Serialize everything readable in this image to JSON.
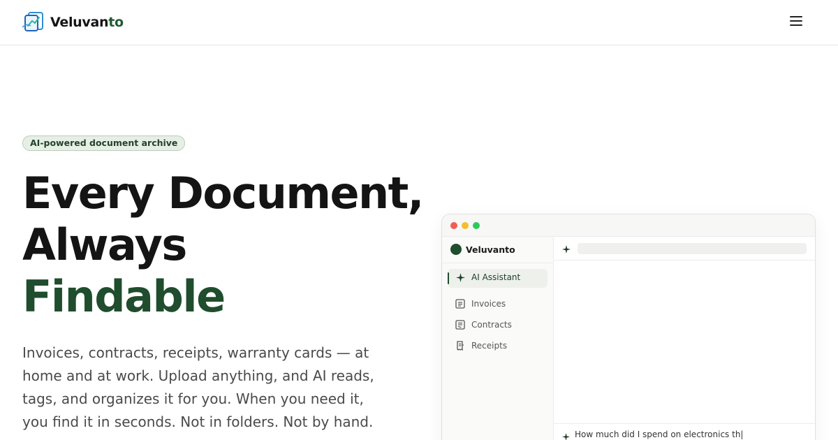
{
  "brand": {
    "name_main": "Veluvan",
    "name_accent": "to",
    "accent_color": "#1f5a33"
  },
  "header": {
    "menu_icon": "hamburger-menu-icon"
  },
  "hero": {
    "badge": "AI-powered document archive",
    "headline_line1": "Every Document,",
    "headline_line2": "Always",
    "headline_line3": "Findable",
    "description": "Invoices, contracts, receipts, warranty cards — at home and at work. Upload anything, and AI reads, tags, and organizes it for you. When you need it, you find it in seconds. Not in folders. Not by hand."
  },
  "app_preview": {
    "window_controls": [
      "close",
      "minimize",
      "maximize"
    ],
    "sidebar": {
      "brand": "Veluvanto",
      "items": [
        {
          "label": "AI Assistant",
          "icon": "sparkle-icon",
          "active": true
        },
        {
          "label": "Invoices",
          "icon": "document-icon",
          "active": false
        },
        {
          "label": "Contracts",
          "icon": "contract-icon",
          "active": false
        },
        {
          "label": "Receipts",
          "icon": "receipt-icon",
          "active": false
        }
      ]
    },
    "chat_input": {
      "text": "How much did I spend on electronics th|"
    }
  },
  "colors": {
    "primary_green": "#1f4d2d",
    "badge_bg": "#e7efe5",
    "text_muted": "#4a4a4a"
  }
}
